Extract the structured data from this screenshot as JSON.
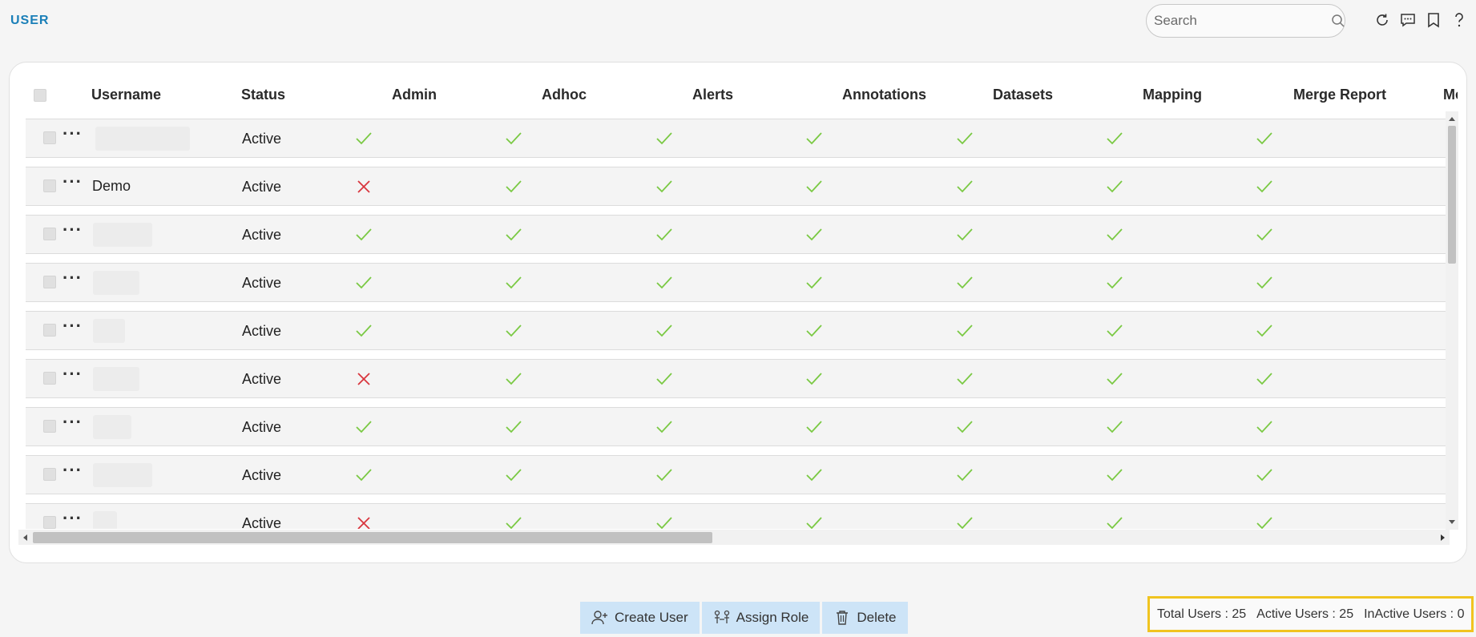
{
  "header": {
    "title": "USER",
    "search": {
      "placeholder": "Search",
      "value": ""
    },
    "icons": [
      "refresh-icon",
      "chat-icon",
      "bookmark-icon",
      "help-icon"
    ]
  },
  "grid": {
    "columns": [
      "Username",
      "Status",
      "Admin",
      "Adhoc",
      "Alerts",
      "Annotations",
      "Datasets",
      "Mapping",
      "Merge Report",
      "Me"
    ],
    "rows": [
      {
        "username": "",
        "status": "Active",
        "perms": [
          true,
          true,
          true,
          true,
          true,
          true,
          true
        ]
      },
      {
        "username": "Demo",
        "status": "Active",
        "perms": [
          false,
          true,
          true,
          true,
          true,
          true,
          true
        ]
      },
      {
        "username": "",
        "status": "Active",
        "perms": [
          true,
          true,
          true,
          true,
          true,
          true,
          true
        ]
      },
      {
        "username": "",
        "status": "Active",
        "perms": [
          true,
          true,
          true,
          true,
          true,
          true,
          true
        ]
      },
      {
        "username": "",
        "status": "Active",
        "perms": [
          true,
          true,
          true,
          true,
          true,
          true,
          true
        ]
      },
      {
        "username": "",
        "status": "Active",
        "perms": [
          false,
          true,
          true,
          true,
          true,
          true,
          true
        ]
      },
      {
        "username": "",
        "status": "Active",
        "perms": [
          true,
          true,
          true,
          true,
          true,
          true,
          true
        ]
      },
      {
        "username": "",
        "status": "Active",
        "perms": [
          true,
          true,
          true,
          true,
          true,
          true,
          true
        ]
      },
      {
        "username": "",
        "status": "Active",
        "perms": [
          false,
          true,
          true,
          true,
          true,
          true,
          true
        ]
      }
    ]
  },
  "actions": {
    "create_user": "Create User",
    "assign_role": "Assign Role",
    "delete": "Delete"
  },
  "stats": {
    "total": "Total Users : 25",
    "active": "Active Users : 25",
    "inactive": "InActive Users : 0"
  },
  "colors": {
    "accent": "#1a7fb8",
    "check": "#7ac943",
    "cross": "#d9363e",
    "button_bg": "#cde4f7",
    "highlight": "#f0c420"
  }
}
